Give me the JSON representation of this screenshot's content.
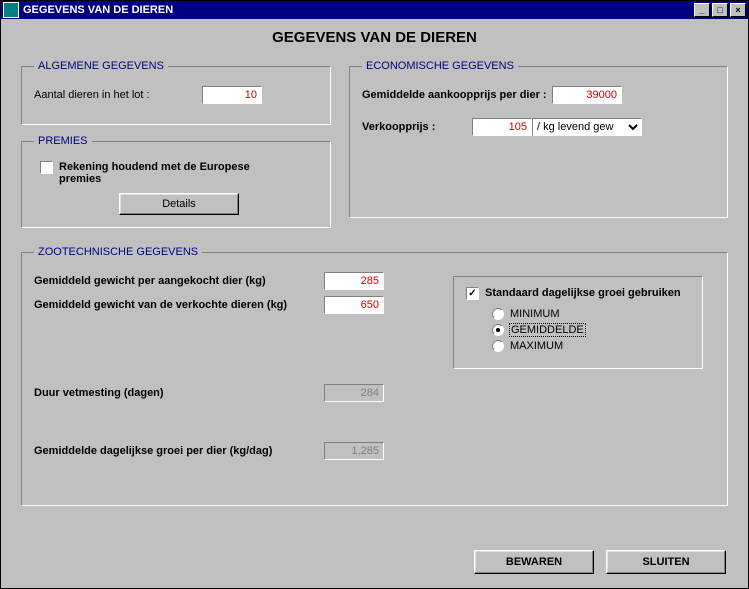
{
  "window": {
    "title": "GEGEVENS VAN DE DIEREN"
  },
  "page": {
    "title": "GEGEVENS VAN DE DIEREN"
  },
  "algemene": {
    "legend": "ALGEMENE GEGEVENS",
    "aantal_label": "Aantal dieren in het lot :",
    "aantal_value": "10"
  },
  "premies": {
    "legend": "PREMIES",
    "check_label": "Rekening houdend met de Europese premies",
    "details_label": "Details"
  },
  "econ": {
    "legend": "ECONOMISCHE GEGEVENS",
    "aankoop_label": "Gemiddelde aankoopprijs per dier :",
    "aankoop_value": "39000",
    "verkoop_label": "Verkoopprijs :",
    "verkoop_value": "105",
    "verkoop_unit": "/ kg levend gew"
  },
  "zoot": {
    "legend": "ZOOTECHNISCHE GEGEVENS",
    "gewicht_aangekocht_label": "Gemiddeld gewicht per aangekocht dier (kg)",
    "gewicht_aangekocht_value": "285",
    "gewicht_verkocht_label": "Gemiddeld gewicht van de verkochte dieren (kg)",
    "gewicht_verkocht_value": "650",
    "duur_label": "Duur vetmesting (dagen)",
    "duur_value": "284",
    "groei_label": "Gemiddelde dagelijkse groei per dier (kg/dag)",
    "groei_value": "1,285",
    "growthbox": {
      "check_label": "Standaard dagelijkse groei gebruiken",
      "opt_min": "MINIMUM",
      "opt_gem": "GEMIDDELDE",
      "opt_max": "MAXIMUM"
    }
  },
  "buttons": {
    "bewaren": "BEWAREN",
    "sluiten": "SLUITEN"
  }
}
